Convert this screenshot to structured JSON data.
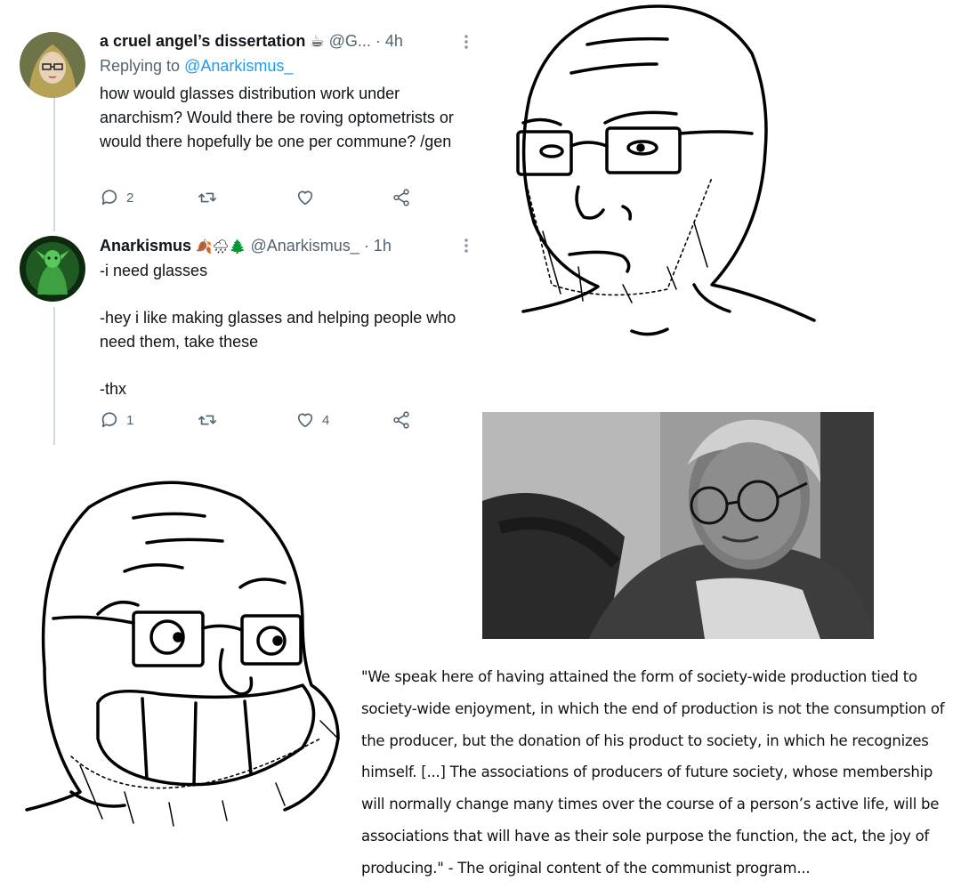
{
  "tweet1": {
    "display_name": "a cruel angel’s dissertation",
    "emoji": "☕",
    "handle": "@G...",
    "time": "· 4h",
    "replying_label": "Replying to",
    "replying_handle": "@Anarkismus_",
    "body": "how would glasses distribution work under anarchism? Would there be roving optometrists or would there hopefully be one per commune? /gen",
    "reply_count": "2",
    "retweet_count": "",
    "like_count": ""
  },
  "tweet2": {
    "display_name": "Anarkismus",
    "emoji": "🍂🌧🌲",
    "handle": "@Anarkismus_",
    "time": "· 1h",
    "lines": [
      "-i need glasses",
      "-hey i like making glasses and helping people who need them, take these",
      "-thx"
    ],
    "reply_count": "1",
    "retweet_count": "",
    "like_count": "4"
  },
  "quote": "\"We speak here of having attained the form of society-wide production tied to society-wide enjoyment, in which the end of production is not the consumption of the producer, but the donation of his product to society, in which he recognizes himself. [...] The associations of producers of future society, whose membership will normally change many times over the course of a person’s active life, will be associations that will have as their sole purpose the function, the act, the joy of producing.\" - The original content of the communist program...",
  "icons": {
    "reply": "reply-icon",
    "retweet": "retweet-icon",
    "like": "heart-icon",
    "share": "share-icon",
    "more": "more-icon"
  },
  "colors": {
    "link": "#1d9bf0",
    "muted": "#536471",
    "thread_line": "#cfd9de"
  }
}
